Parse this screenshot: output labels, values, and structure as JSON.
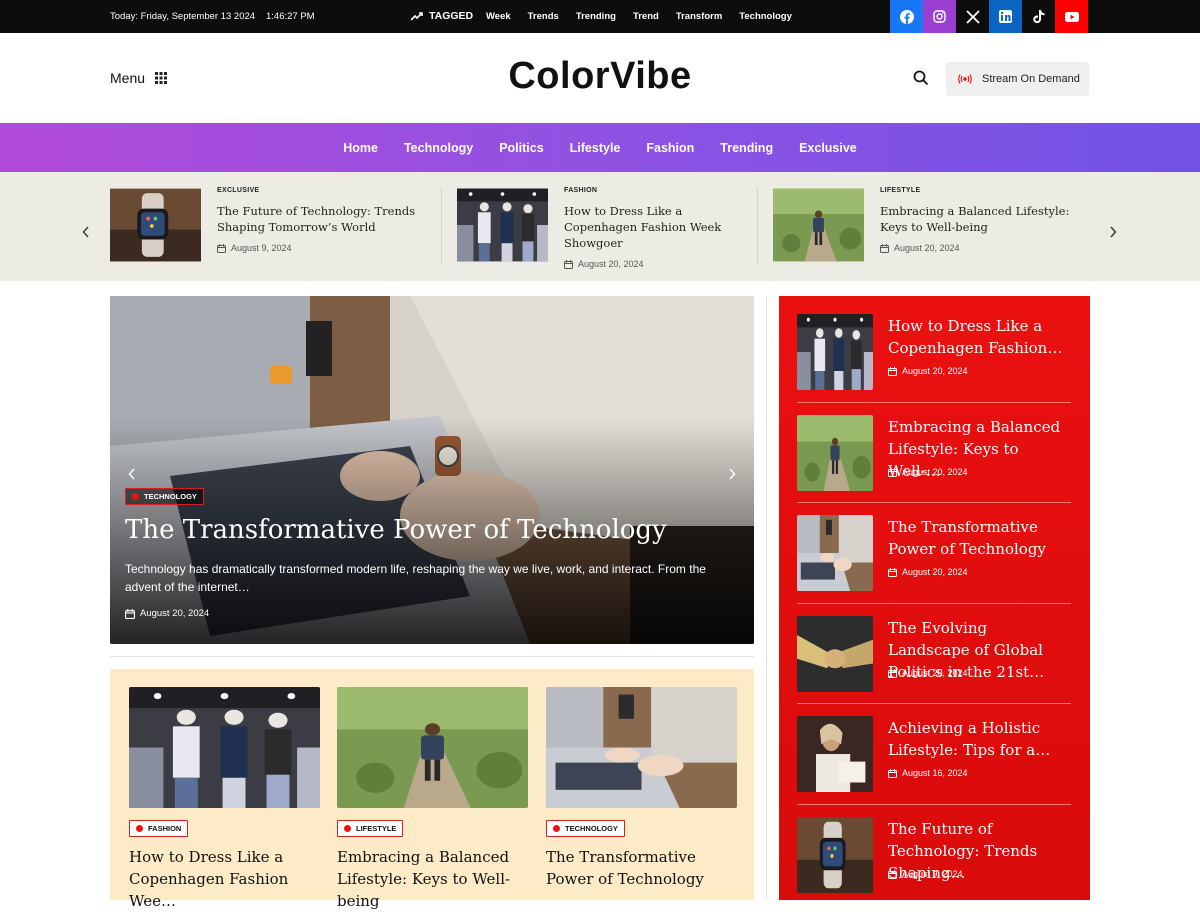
{
  "topbar": {
    "date": "Today: Friday, September 13 2024",
    "time": "1:46:27 PM",
    "tagged_label": "TAGGED",
    "tags": [
      "Week",
      "Trends",
      "Trending",
      "Trend",
      "Transform",
      "Technology"
    ],
    "social": [
      {
        "icon": "facebook-icon",
        "color": "#1877f2"
      },
      {
        "icon": "instagram-icon",
        "color": "#9a3fd0"
      },
      {
        "icon": "x-icon",
        "color": "#0d0d0d"
      },
      {
        "icon": "linkedin-icon",
        "color": "#0a66c2"
      },
      {
        "icon": "tiktok-icon",
        "color": "#0d0d0d"
      },
      {
        "icon": "youtube-icon",
        "color": "#ff0000"
      }
    ]
  },
  "header": {
    "menu_label": "Menu",
    "logo": "ColorVibe",
    "stream_label": "Stream On Demand"
  },
  "nav": {
    "items": [
      "Home",
      "Technology",
      "Politics",
      "Lifestyle",
      "Fashion",
      "Trending",
      "Exclusive"
    ]
  },
  "ticker": {
    "items": [
      {
        "category": "EXCLUSIVE",
        "title": "The Future of Technology: Trends Shaping Tomorrow’s World",
        "date": "August 9, 2024",
        "image": "watch-icon"
      },
      {
        "category": "FASHION",
        "title": "How to Dress Like a Copenhagen Fashion Week Showgoer",
        "date": "August 20, 2024",
        "image": "mannequins-icon"
      },
      {
        "category": "LIFESTYLE",
        "title": "Embracing a Balanced Lifestyle: Keys to Well-being",
        "date": "August 20, 2024",
        "image": "hiker-icon"
      }
    ]
  },
  "hero": {
    "category": "TECHNOLOGY",
    "title": "The Transformative Power of Technology",
    "excerpt": "Technology has dramatically transformed modern life, reshaping the way we live, work, and interact. From the advent of the internet…",
    "date": "August 20, 2024"
  },
  "cards": [
    {
      "category": "FASHION",
      "title": "How to Dress Like a Copenhagen Fashion Wee…",
      "image": "mannequins-icon"
    },
    {
      "category": "LIFESTYLE",
      "title": "Embracing a Balanced Lifestyle: Keys to Well-being",
      "image": "hiker-icon"
    },
    {
      "category": "TECHNOLOGY",
      "title": "The Transformative Power of Technology",
      "image": "laptop-icon"
    }
  ],
  "sidebar": {
    "items": [
      {
        "title": "How to Dress Like a Copenhagen Fashion…",
        "date": "August 20, 2024",
        "image": "mannequins-icon"
      },
      {
        "title": "Embracing a Balanced Lifestyle: Keys to Well-…",
        "date": "August 20, 2024",
        "image": "hiker-icon"
      },
      {
        "title": "The Transformative Power of Technology",
        "date": "August 20, 2024",
        "image": "laptop-icon"
      },
      {
        "title": "The Evolving Landscape of Global Politics in the 21st…",
        "date": "August 20, 2024",
        "image": "handshake-icon"
      },
      {
        "title": "Achieving a Holistic Lifestyle: Tips for a…",
        "date": "August 16, 2024",
        "image": "reading-icon"
      },
      {
        "title": "The Future of Technology: Trends Shaping…",
        "date": "August 9, 2024",
        "image": "watch-icon"
      }
    ]
  },
  "colors": {
    "accent_red": "#e30f0f",
    "nav_gradient_start": "#b249d8",
    "nav_gradient_end": "#7153e6",
    "cards_bg": "#fdebc8",
    "ticker_bg": "#edece4"
  }
}
